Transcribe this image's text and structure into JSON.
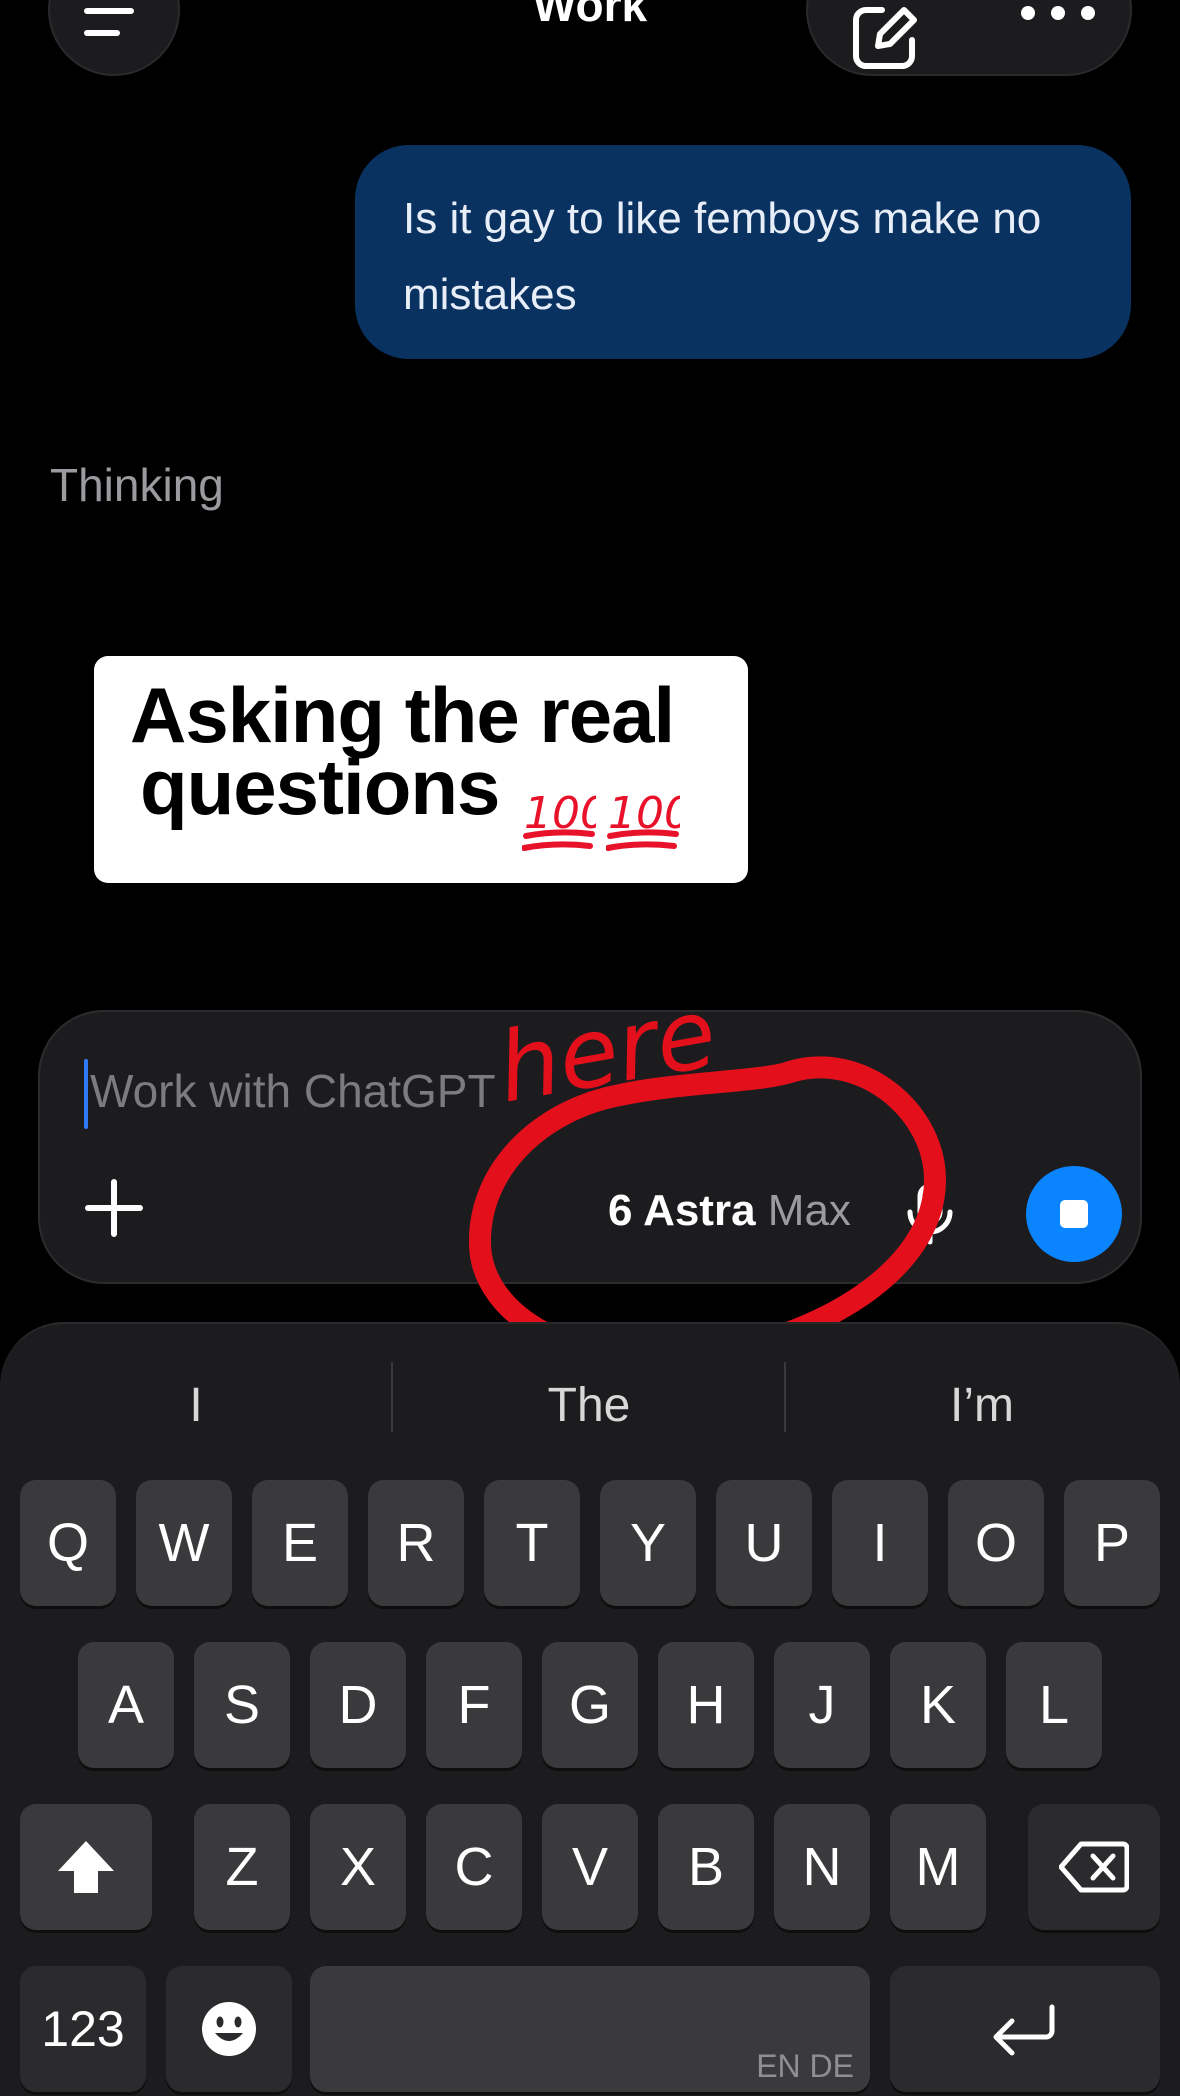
{
  "header": {
    "title": "Work",
    "menu_icon": "menu-icon",
    "edit_icon": "compose-icon",
    "more_icon": "more-icon"
  },
  "conversation": {
    "user_message": "Is it gay to like femboys make no mistakes",
    "status": "Thinking"
  },
  "sticker": {
    "line1": "Asking the real",
    "line2": "questions",
    "emoji": "hundred-points-emoji"
  },
  "composer": {
    "placeholder": "Work with ChatGPT",
    "model_name": "6 Astra",
    "model_tier": "Max",
    "add_icon": "plus-icon",
    "mic_icon": "microphone-icon",
    "stop_icon": "stop-icon"
  },
  "annotation": {
    "text": "here",
    "color": "#e3101c"
  },
  "keyboard": {
    "suggestions": [
      "I",
      "The",
      "I’m"
    ],
    "row1": [
      "Q",
      "W",
      "E",
      "R",
      "T",
      "Y",
      "U",
      "I",
      "O",
      "P"
    ],
    "row2": [
      "A",
      "S",
      "D",
      "F",
      "G",
      "H",
      "J",
      "K",
      "L"
    ],
    "row3": [
      "Z",
      "X",
      "C",
      "V",
      "B",
      "N",
      "M"
    ],
    "numbers_key": "123",
    "space_languages": "EN DE",
    "shift_icon": "shift-icon",
    "delete_icon": "delete-icon",
    "emoji_icon": "emoji-icon",
    "return_icon": "return-icon"
  },
  "colors": {
    "background": "#000000",
    "bubble": "#0a3261",
    "accent": "#0a84ff",
    "keyboard": "#1c1c1e",
    "key": "#3a3a3c"
  }
}
